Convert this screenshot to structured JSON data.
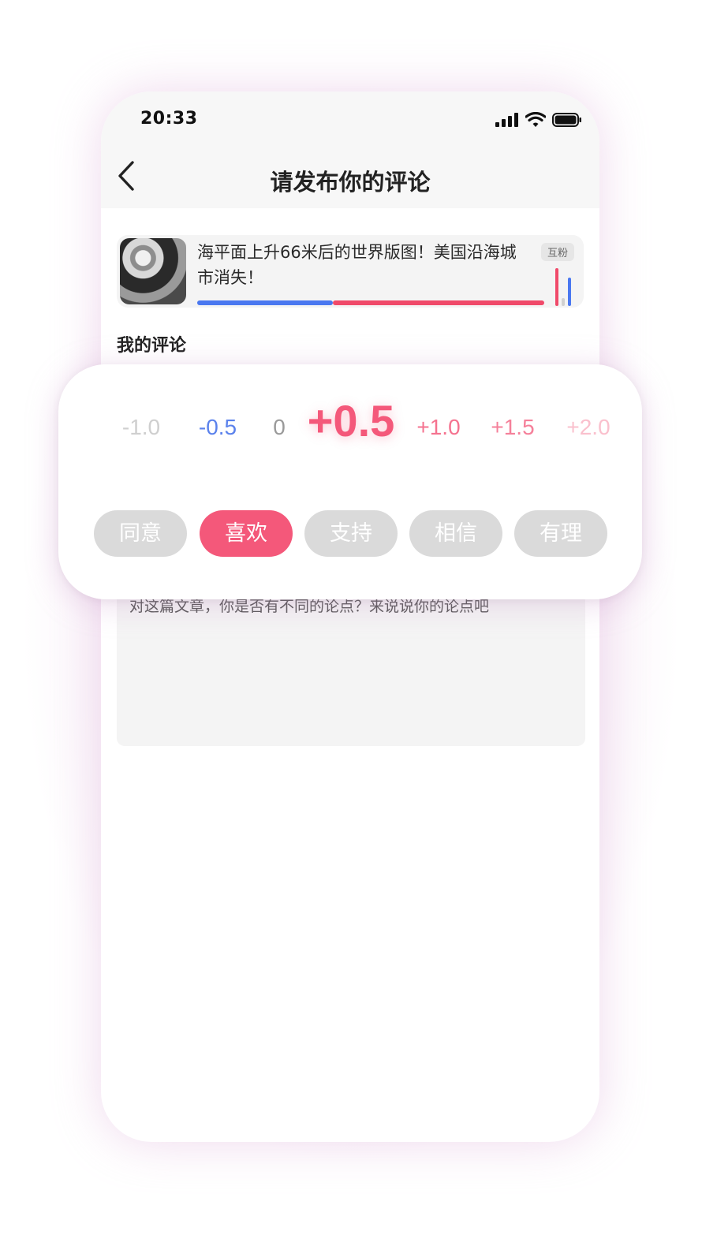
{
  "status_bar": {
    "time": "20:33"
  },
  "header": {
    "title": "请发布你的评论"
  },
  "article": {
    "title": "海平面上升66米后的世界版图！美国沿海城市消失！",
    "tag": "互粉",
    "progress_split": 0.39
  },
  "my_comment": {
    "label": "我的评论",
    "placeholder": "对这篇文章，你是否有不同的论点？来说说你的论点吧"
  },
  "rating": {
    "scale": [
      "-1.0",
      "-0.5",
      "0",
      "+0.5",
      "+1.0",
      "+1.5",
      "+2.0"
    ],
    "selected": "+0.5",
    "reactions": [
      {
        "label": "同意",
        "active": false
      },
      {
        "label": "喜欢",
        "active": true
      },
      {
        "label": "支持",
        "active": false
      },
      {
        "label": "相信",
        "active": false
      },
      {
        "label": "有理",
        "active": false
      }
    ]
  },
  "colors": {
    "accent_pink": "#f4587a",
    "accent_blue": "#4a78f0",
    "chip_inactive": "#dadada"
  }
}
